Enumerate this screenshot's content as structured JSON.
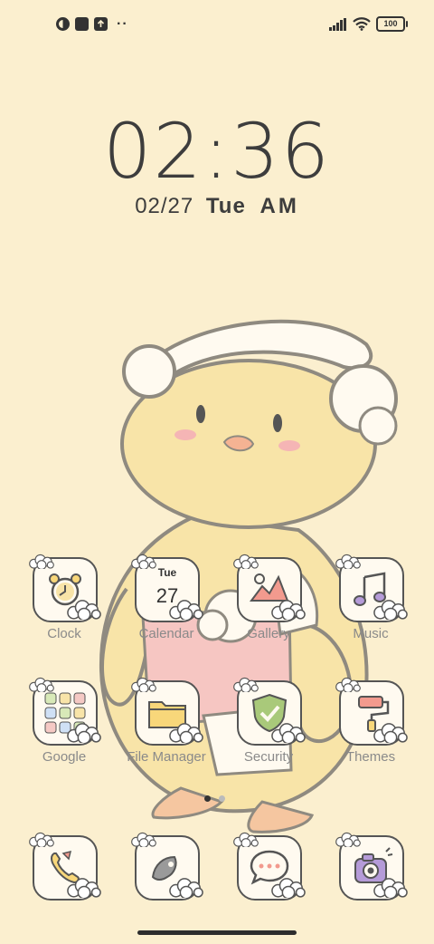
{
  "status_bar": {
    "left_icons": [
      "browser-icon",
      "app-square-icon",
      "upload-icon",
      "more-dots-icon"
    ],
    "more_indicator": "··",
    "right_icons": [
      "signal-icon",
      "wifi-icon",
      "battery-icon"
    ],
    "battery_level": "100"
  },
  "lock": {
    "time": "02:36",
    "date": "02/27",
    "weekday": "Tue",
    "ampm": "AM"
  },
  "calendar_widget": {
    "weekday": "Tue",
    "day": "27"
  },
  "apps_row1": [
    {
      "label": "Clock",
      "icon": "alarm-clock-icon"
    },
    {
      "label": "Calendar",
      "icon": "calendar-icon"
    },
    {
      "label": "Gallery",
      "icon": "gallery-icon"
    },
    {
      "label": "Music",
      "icon": "music-note-icon"
    }
  ],
  "apps_row2": [
    {
      "label": "Google",
      "icon": "google-folder-icon"
    },
    {
      "label": "File Manager",
      "icon": "folder-icon"
    },
    {
      "label": "Security",
      "icon": "shield-check-icon"
    },
    {
      "label": "Themes",
      "icon": "paint-roller-icon"
    }
  ],
  "dock": [
    {
      "icon": "phone-icon"
    },
    {
      "icon": "browser-icon"
    },
    {
      "icon": "messages-icon"
    },
    {
      "icon": "camera-icon"
    }
  ],
  "pager": {
    "pages": 2,
    "current": 1
  },
  "colors": {
    "background": "#FBEFCF",
    "accent_yellow": "#F8E3A0",
    "pink": "#F5C9C4"
  }
}
